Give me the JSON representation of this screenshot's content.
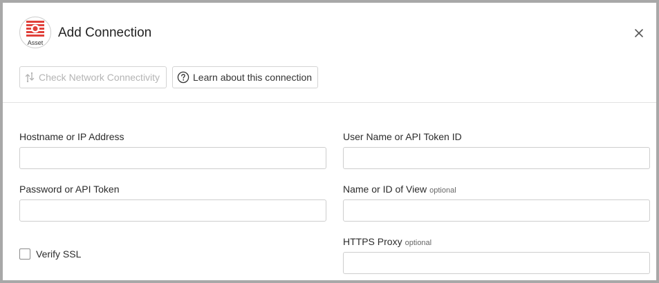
{
  "dialog": {
    "title": "Add Connection",
    "logo_caption": "Asset",
    "logo_color": "#e0403a"
  },
  "toolbar": {
    "check_network_label": "Check Network Connectivity",
    "learn_label": "Learn about this connection"
  },
  "form": {
    "hostname_label": "Hostname or IP Address",
    "username_label": "User Name or API Token ID",
    "password_label": "Password or API Token",
    "view_label": "Name or ID of View",
    "proxy_label": "HTTPS Proxy",
    "optional_text": "optional",
    "verify_ssl_label": "Verify SSL",
    "hostname_value": "",
    "username_value": "",
    "password_value": "",
    "view_value": "",
    "proxy_value": ""
  },
  "icons": {
    "logo": "asset-logo-icon",
    "close": "close-icon",
    "network": "network-connectivity-icon",
    "help": "question-circle-icon"
  }
}
